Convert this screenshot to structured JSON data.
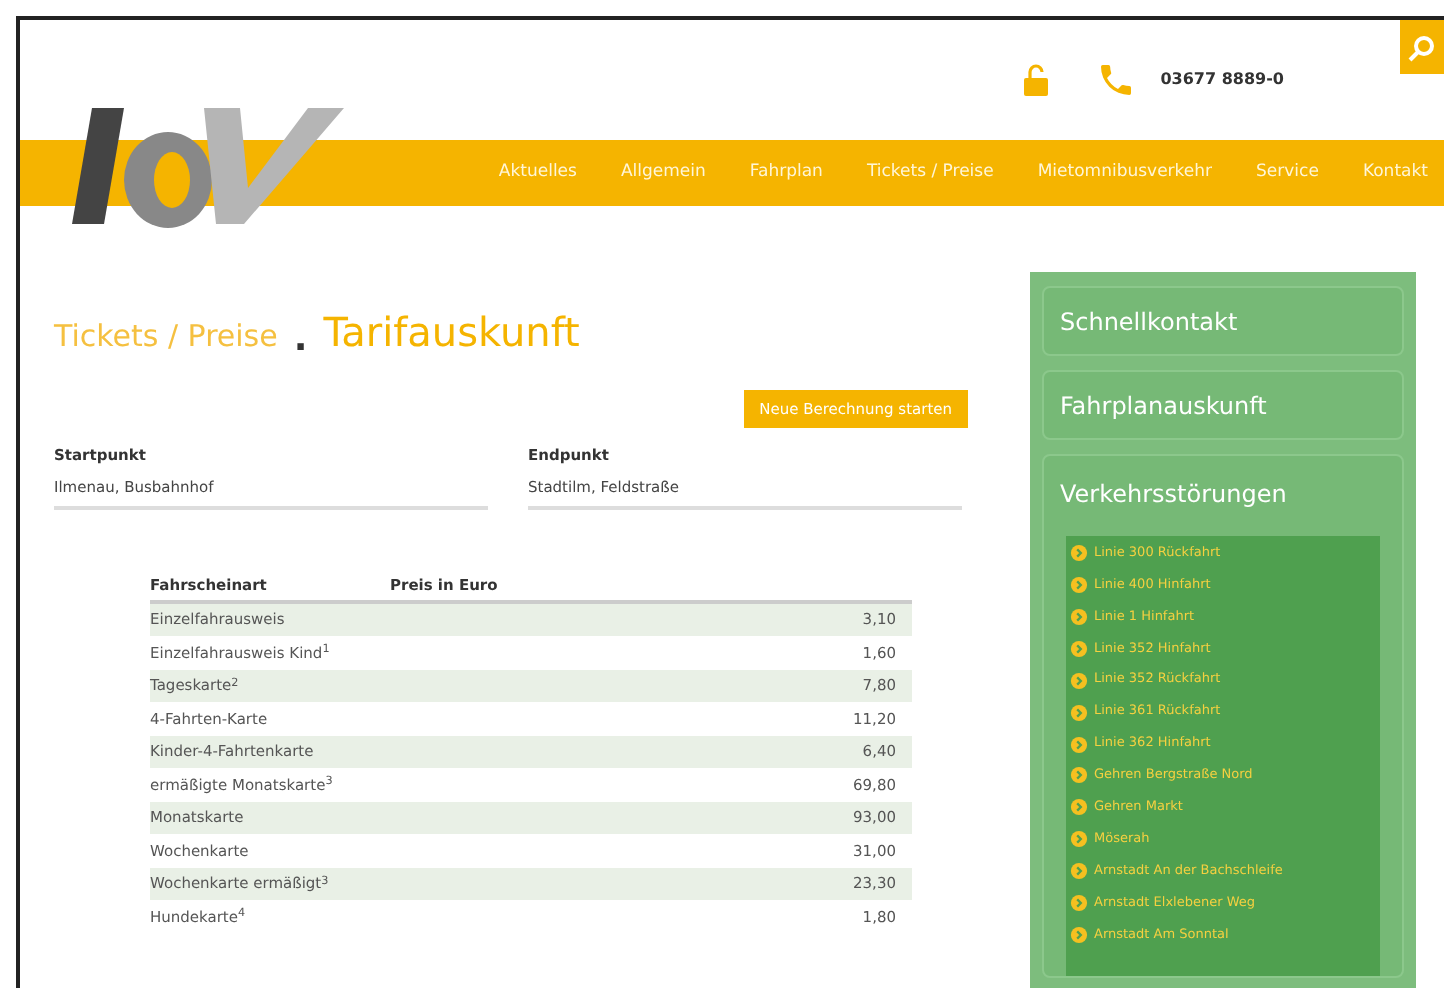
{
  "header": {
    "phone": "03677 8889-0"
  },
  "nav": [
    "Aktuelles",
    "Allgemein",
    "Fahrplan",
    "Tickets / Preise",
    "Mietomnibusverkehr",
    "Service",
    "Kontakt"
  ],
  "breadcrumb": {
    "parent": "Tickets / Preise",
    "separator": ".",
    "title": "Tarifauskunft"
  },
  "action_button": "Neue Berechnung starten",
  "fields": [
    {
      "label": "Startpunkt",
      "value": "Ilmenau, Busbahnhof"
    },
    {
      "label": "Endpunkt",
      "value": "Stadtilm, Feldstraße"
    }
  ],
  "table": {
    "columns": [
      "Fahrscheinart",
      "Preis in Euro"
    ],
    "rows": [
      {
        "name": "Einzelfahrausweis",
        "price": "3,10"
      },
      {
        "name": "Einzelfahrausweis Kind$^{1}$",
        "price": "1,60"
      },
      {
        "name": "Tageskarte$^{2}$",
        "price": "7,80"
      },
      {
        "name": "4-Fahrten-Karte",
        "price": "11,20"
      },
      {
        "name": "Kinder-4-Fahrtenkarte",
        "price": "6,40"
      },
      {
        "name": "ermäßigte Monatskarte$^{3}$",
        "price": "69,80"
      },
      {
        "name": "Monatskarte",
        "price": "93,00"
      },
      {
        "name": "Wochenkarte",
        "price": "31,00"
      },
      {
        "name": "Wochenkarte ermäßigt$^{3}$",
        "price": "23,30"
      },
      {
        "name": "Hundekarte$^{4}$",
        "price": "1,80"
      }
    ]
  },
  "sidebar": {
    "panels": [
      "Schnellkontakt",
      "Fahrplanauskunft"
    ],
    "disruptions": {
      "title": "Verkehrsstörungen",
      "items": [
        "Linie 300 Rückfahrt",
        "Linie 400 Hinfahrt",
        "Linie 1 Hinfahrt",
        "Linie 352 Hinfahrt",
        "Linie 352 Rückfahrt",
        "Linie 361 Rückfahrt",
        "Linie 362 Hinfahrt",
        "Gehren Bergstraße Nord",
        "Gehren Markt",
        "Möserah",
        "Arnstadt An der Bachschleife",
        "Arnstadt Elxlebener Weg",
        "Arnstadt Am Sonntal"
      ]
    }
  }
}
